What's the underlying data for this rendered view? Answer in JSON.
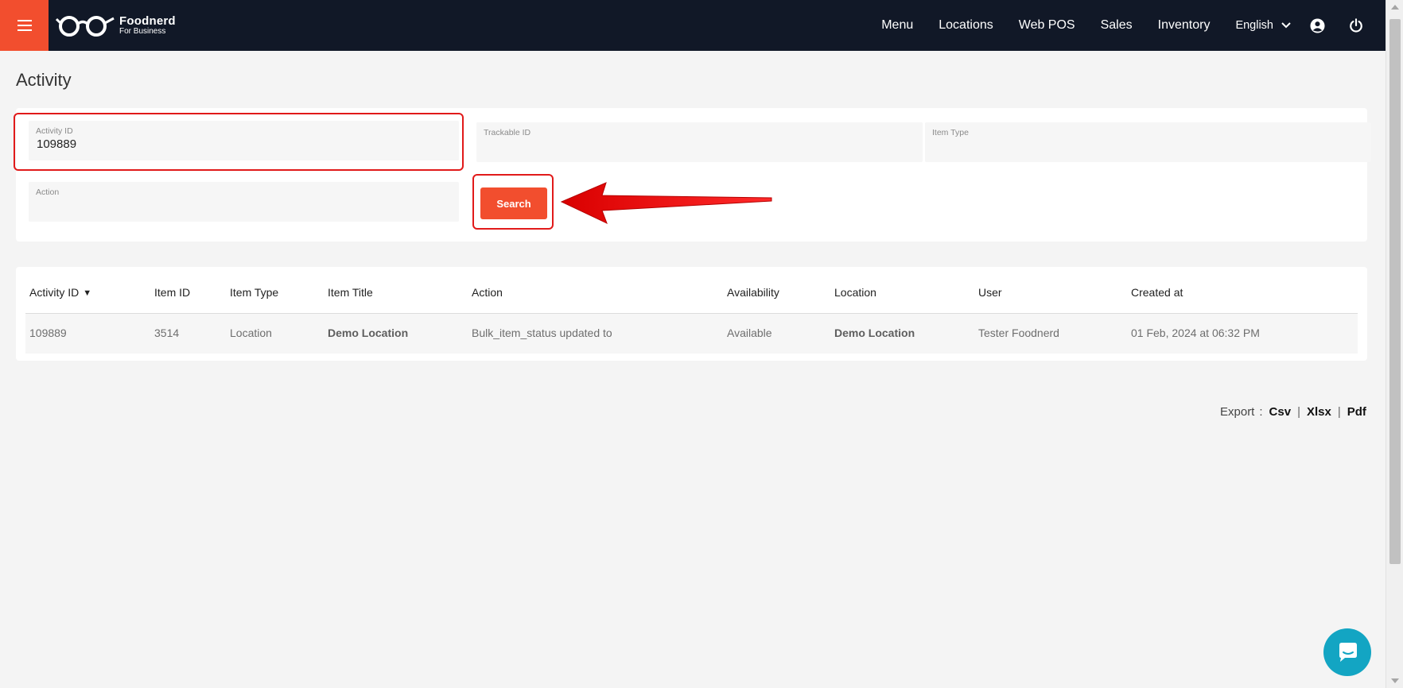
{
  "brand": {
    "name": "Foodnerd",
    "tagline": "For Business",
    "accent_color": "#f24e2e",
    "nav_bg": "#111827"
  },
  "nav": {
    "items": [
      "Menu",
      "Locations",
      "Web POS",
      "Sales",
      "Inventory"
    ],
    "language": "English",
    "icons": [
      "hamburger-icon",
      "glasses-logo-icon",
      "chevron-down-icon",
      "user-circle-icon",
      "power-icon"
    ]
  },
  "page": {
    "title": "Activity"
  },
  "filters": {
    "activity_id": {
      "label": "Activity ID",
      "value": "109889"
    },
    "trackable_id": {
      "label": "Trackable ID",
      "value": ""
    },
    "item_type": {
      "label": "Item Type",
      "value": ""
    },
    "action": {
      "label": "Action",
      "value": ""
    },
    "search_label": "Search"
  },
  "table": {
    "columns": [
      "Activity ID",
      "Item ID",
      "Item Type",
      "Item Title",
      "Action",
      "Availability",
      "Location",
      "User",
      "Created at"
    ],
    "sort_indicator": "▼",
    "rows": [
      [
        "109889",
        "3514",
        "Location",
        "Demo Location",
        "Bulk_item_status updated to",
        "Available",
        "Demo Location",
        "Tester Foodnerd",
        "01 Feb, 2024 at 06:32 PM"
      ]
    ]
  },
  "export": {
    "label": "Export",
    "colon": ":",
    "separator": "|",
    "formats": [
      "Csv",
      "Xlsx",
      "Pdf"
    ]
  },
  "annotation": {
    "highlight_color": "#e11a1a",
    "chat_color": "#13a5c3"
  }
}
